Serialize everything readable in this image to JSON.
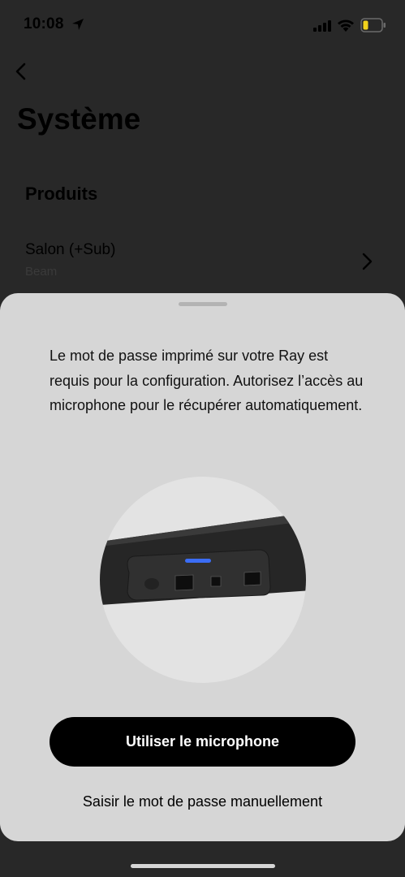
{
  "status_bar": {
    "time": "10:08",
    "icons": [
      "location-arrow-icon",
      "cellular-signal-icon",
      "wifi-icon",
      "battery-low-icon"
    ],
    "battery_color": "#f2d21b"
  },
  "page": {
    "title": "Système",
    "section_title": "Produits",
    "products": [
      {
        "name": "Salon (+Sub)",
        "model": "Beam"
      }
    ]
  },
  "sheet": {
    "message": "Le mot de passe imprimé sur votre Ray est requis pour la configuration. Autorisez l’accès au microphone pour le récupérer automatiquement.",
    "illustration": "ray-rear-ports-illustration",
    "primary_button_label": "Utiliser le microphone",
    "secondary_link_label": "Saisir le mot de passe manuellement"
  },
  "colors": {
    "background_dim": "#282828",
    "sheet_background": "#d6d6d6",
    "button_background": "#000000",
    "button_text": "#ffffff",
    "led_blue": "#3b6df5"
  }
}
